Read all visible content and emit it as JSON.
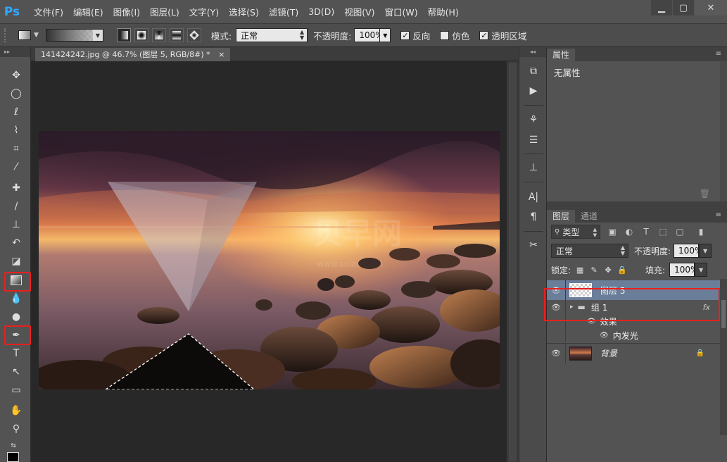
{
  "app": {
    "logo": "Ps"
  },
  "menu": [
    "文件(F)",
    "编辑(E)",
    "图像(I)",
    "图层(L)",
    "文字(Y)",
    "选择(S)",
    "滤镜(T)",
    "3D(D)",
    "视图(V)",
    "窗口(W)",
    "帮助(H)"
  ],
  "window_controls": {
    "minimize": "▁",
    "maximize": "▢",
    "close": "✕"
  },
  "options": {
    "mode_label": "模式:",
    "mode_value": "正常",
    "opacity_label": "不透明度:",
    "opacity_value": "100%",
    "reverse": "反向",
    "dither": "仿色",
    "transparency": "透明区域",
    "reverse_checked": true,
    "dither_checked": false,
    "transparency_checked": true
  },
  "document": {
    "tab_title": "141424242.jpg @ 46.7% (图层 5, RGB/8#) *",
    "tab_close": "×",
    "watermark": "贝早网",
    "watermark_url": "www.sxiaw.com"
  },
  "tools": [
    "move-tool",
    "elliptical-marquee-tool",
    "lasso-tool",
    "quick-selection-tool",
    "crop-tool",
    "eyedropper-tool",
    "spot-healing-tool",
    "brush-tool",
    "clone-stamp-tool",
    "history-brush-tool",
    "eraser-tool",
    "gradient-tool",
    "blur-tool",
    "dodge-tool",
    "pen-tool",
    "type-tool",
    "path-selection-tool",
    "rectangle-tool",
    "hand-tool",
    "zoom-tool"
  ],
  "properties": {
    "tab": "属性",
    "content": "无属性"
  },
  "layers_panel": {
    "tabs": [
      "图层",
      "通道"
    ],
    "kind_label": "类型",
    "blend_mode": "正常",
    "opacity_label": "不透明度:",
    "opacity_value": "100%",
    "lock_label": "锁定:",
    "fill_label": "填充:",
    "fill_value": "100%",
    "layers": [
      {
        "name": "图层 5",
        "selected": true
      },
      {
        "name": "组 1",
        "fx": "fx"
      },
      {
        "name": "效果"
      },
      {
        "name": "内发光"
      },
      {
        "name": "背景",
        "locked": true
      }
    ]
  },
  "colors": {
    "highlight_red": "#e8201e",
    "selected_layer": "#6a7d99",
    "ps_blue": "#31a8ff"
  }
}
